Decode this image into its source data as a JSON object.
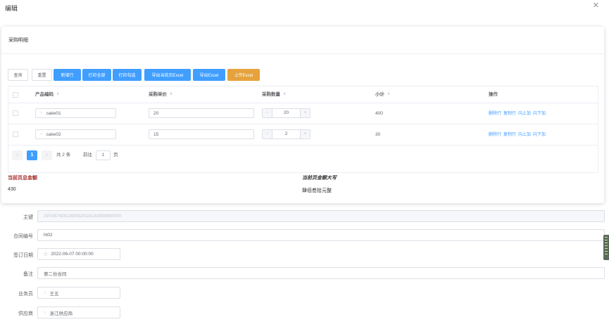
{
  "dialog": {
    "title": "编辑",
    "close_glyph": "✕"
  },
  "card": {
    "title": "采购明细"
  },
  "toolbar": {
    "query": "查询",
    "reset": "重置",
    "add_row": "新增行",
    "print_all": "打印全部",
    "print_selected": "打印勾选",
    "export_page": "导出当前页Excel",
    "export": "导出Excel",
    "upload": "上传Excel"
  },
  "table": {
    "columns": [
      "产品编码",
      "采购单价",
      "采购数量",
      "小计",
      "操作"
    ],
    "sort_glyph": "⬍",
    "rows": [
      {
        "code": "cake01",
        "price": "20",
        "qty": "20",
        "subtotal": "400"
      },
      {
        "code": "cake02",
        "price": "15",
        "qty": "2",
        "subtotal": "30"
      }
    ],
    "ops": [
      "删除行",
      "复制行",
      "向上加",
      "向下加"
    ],
    "stepper_minus": "−",
    "stepper_plus": "+"
  },
  "pager": {
    "prev": "‹",
    "next": "›",
    "current": "1",
    "total": "共 2 条",
    "goto_prefix": "前往",
    "goto_value": "1",
    "goto_suffix": "页"
  },
  "summary": {
    "total_label": "当前页总金额",
    "total_value": "430",
    "upper_label": "当前页金额大写",
    "upper_value": "肆佰叁拾元整",
    "total_label_color": "#a52a2a",
    "upper_label_color": "#303133"
  },
  "form": {
    "pk_label": "主键",
    "pk_value": "297e5742813bf05201813cf30bf90000",
    "contract_label": "合同编号",
    "contract_value": "ht02",
    "date_label": "签订日期",
    "date_value": "2022-06-07 00:00:00",
    "remark_label": "备注",
    "remark_value": "第二份合同",
    "sales_label": "业务员",
    "sales_value": "王五",
    "supplier_label": "供应商",
    "supplier_value": "浙江供应商"
  },
  "colors": {
    "primary": "#409eff",
    "warning": "#e6a23c",
    "border": "#dcdfe6"
  }
}
